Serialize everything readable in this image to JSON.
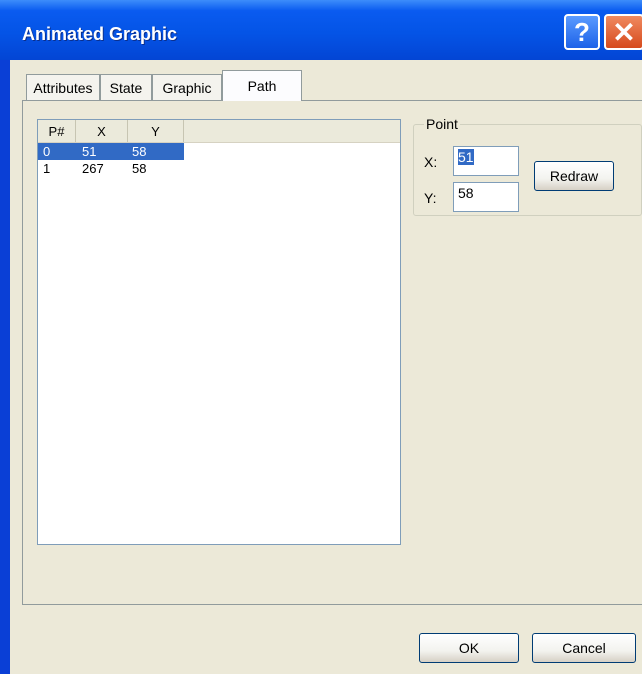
{
  "window": {
    "title": "Animated Graphic"
  },
  "titlebar_buttons": {
    "help": "?",
    "close": "✕"
  },
  "tabs": [
    {
      "label": "Attributes",
      "active": false
    },
    {
      "label": "State",
      "active": false
    },
    {
      "label": "Graphic",
      "active": false
    },
    {
      "label": "Path",
      "active": true
    }
  ],
  "path_list": {
    "columns": [
      "P#",
      "X",
      "Y"
    ],
    "rows": [
      {
        "p": "0",
        "x": "51",
        "y": "58",
        "selected": true
      },
      {
        "p": "1",
        "x": "267",
        "y": "58",
        "selected": false
      }
    ]
  },
  "point": {
    "group_label": "Point",
    "x_label": "X:",
    "y_label": "Y:",
    "x_value": "51",
    "y_value": "58",
    "redraw_label": "Redraw"
  },
  "footer": {
    "ok_label": "OK",
    "cancel_label": "Cancel"
  },
  "colors": {
    "titlebar": "#0454e6",
    "face": "#ece9d8",
    "selection": "#316ac5"
  }
}
